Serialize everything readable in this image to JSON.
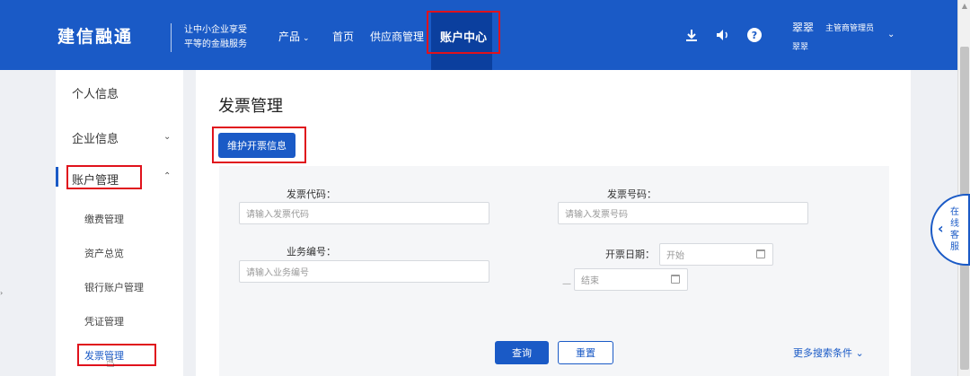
{
  "header": {
    "logo": "建信融通",
    "slogan_line1": "让中小企业享受",
    "slogan_line2": "平等的金融服务",
    "nav": [
      {
        "label": "产品"
      },
      {
        "label": "首页"
      },
      {
        "label": "供应商管理"
      },
      {
        "label": "账户中心"
      }
    ],
    "user": {
      "name": "翠翠",
      "role": "主管商管理员",
      "sub": "翠翠"
    },
    "icons": {
      "download": "download-icon",
      "sound": "speaker-icon",
      "help": "help-icon"
    }
  },
  "sidebar": {
    "items": [
      {
        "label": "个人信息"
      },
      {
        "label": "企业信息"
      },
      {
        "label": "账户管理"
      }
    ],
    "sub_items": [
      {
        "label": "缴费管理"
      },
      {
        "label": "资产总览"
      },
      {
        "label": "银行账户管理"
      },
      {
        "label": "凭证管理"
      },
      {
        "label": "发票管理"
      }
    ]
  },
  "main": {
    "title": "发票管理",
    "maintain_button": "维护开票信息",
    "fields": {
      "invoice_code_label": "发票代码：",
      "invoice_code_placeholder": "请输入发票代码",
      "invoice_no_label": "发票号码：",
      "invoice_no_placeholder": "请输入发票号码",
      "business_no_label": "业务编号：",
      "business_no_placeholder": "请输入业务编号",
      "date_label": "开票日期：",
      "date_start": "开始",
      "date_end": "结束"
    },
    "query_button": "查询",
    "reset_button": "重置",
    "more_search": "更多搜索条件"
  },
  "service": {
    "label": "在线客服"
  },
  "colors": {
    "brand": "#1a5ac6",
    "highlight": "#e0121c"
  }
}
